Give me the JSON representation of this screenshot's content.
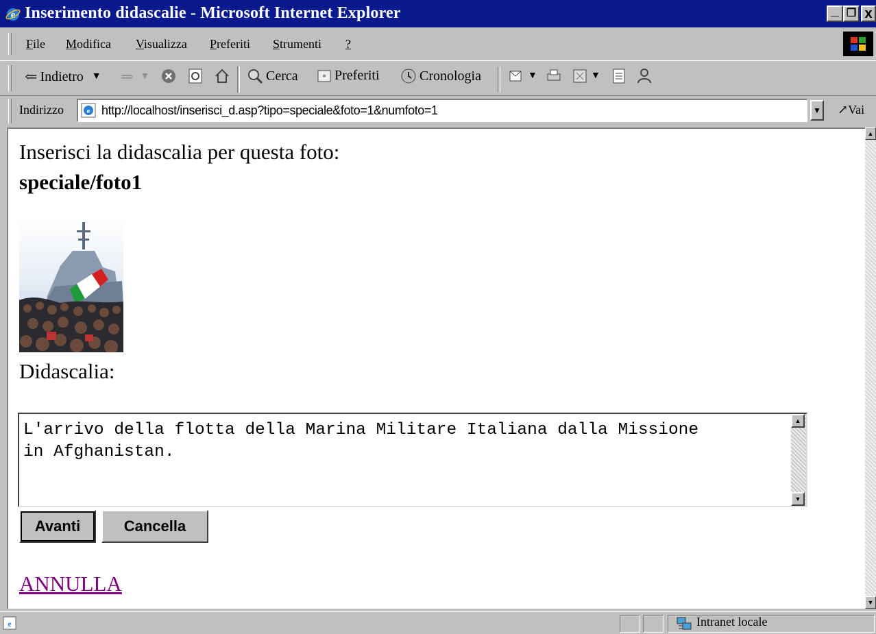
{
  "window": {
    "title": "Inserimento didascalie - Microsoft Internet Explorer",
    "controls": {
      "minimize": "_",
      "restore": "❐",
      "close": "x"
    }
  },
  "menu": {
    "items": [
      {
        "label": "File",
        "underline": "F",
        "rest": "ile"
      },
      {
        "label": "Modifica",
        "underline": "M",
        "rest": "odifica"
      },
      {
        "label": "Visualizza",
        "underline": "V",
        "rest": "isualizza"
      },
      {
        "label": "Preferiti",
        "underline": "P",
        "rest": "referiti"
      },
      {
        "label": "Strumenti",
        "underline": "S",
        "rest": "trumenti"
      },
      {
        "label": "?",
        "underline": "?",
        "rest": ""
      }
    ]
  },
  "toolbar": {
    "back": "Indietro",
    "search": "Cerca",
    "favorites": "Preferiti",
    "history": "Cronologia"
  },
  "address": {
    "label": "Indirizzo",
    "url": "http://localhost/inserisci_d.asp?tipo=speciale&foto=1&numfoto=1",
    "go": "Vai"
  },
  "page": {
    "heading": "Inserisci la didascalia per questa foto:",
    "photo_name": "speciale/foto1",
    "caption_label": "Didascalia:",
    "caption_value": "L'arrivo della flotta della Marina Militare Italiana dalla Missione\nin Afghanistan.",
    "submit_label": "Avanti",
    "reset_label": "Cancella",
    "cancel_link": "ANNULLA"
  },
  "status": {
    "zone": "Intranet locale"
  },
  "colors": {
    "titlebar": "#0a1a8c",
    "chrome": "#c0c0c0",
    "visited_link": "#800080"
  }
}
